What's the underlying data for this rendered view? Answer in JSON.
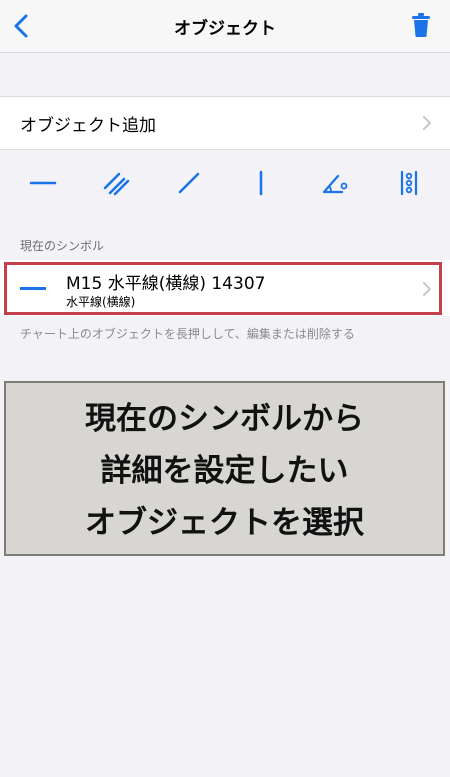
{
  "nav": {
    "title": "オブジェクト",
    "back_icon": "chevron-left-icon",
    "trash_icon": "trash-icon"
  },
  "add_row": {
    "label": "オブジェクト追加"
  },
  "toolbar": {
    "tools": [
      "horizontal-line-icon",
      "parallel-lines-icon",
      "trendline-icon",
      "vertical-line-icon",
      "angle-tool-icon",
      "more-tools-icon"
    ]
  },
  "section": {
    "header": "現在のシンボル"
  },
  "symbol_item": {
    "title": "M15 水平線(横線) 14307",
    "subtitle": "水平線(横線)"
  },
  "hint": "チャート上のオブジェクトを長押しして、編集または削除する",
  "callout": {
    "lines": [
      "現在のシンボルから",
      "詳細を設定したい",
      "オブジェクトを選択"
    ]
  },
  "colors": {
    "accent": "#1a73e8",
    "highlight": "#c4404a",
    "background": "#f2f2f7"
  }
}
